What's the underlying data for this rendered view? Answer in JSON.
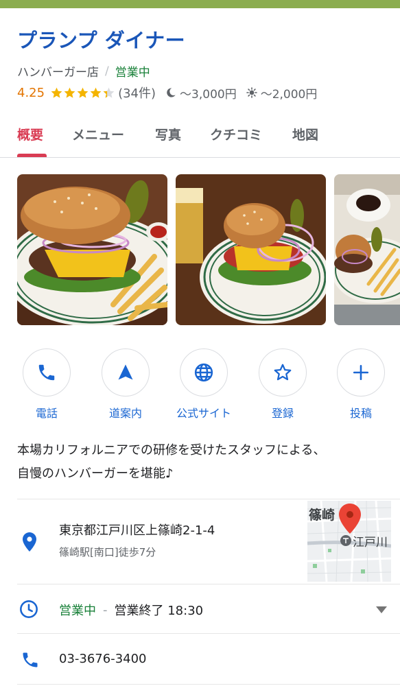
{
  "header": {
    "title": "プランプ ダイナー",
    "category": "ハンバーガー店",
    "separator": "/",
    "status": "営業中"
  },
  "rating": {
    "score": "4.25",
    "stars": 4.25,
    "count": "(34件)",
    "dinner_price": "～3,000円",
    "lunch_price": "～2,000円",
    "dinner_icon": "moon-icon",
    "lunch_icon": "sun-icon"
  },
  "tabs": [
    {
      "label": "概要",
      "active": true
    },
    {
      "label": "メニュー",
      "active": false
    },
    {
      "label": "写真",
      "active": false
    },
    {
      "label": "クチコミ",
      "active": false
    },
    {
      "label": "地図",
      "active": false
    }
  ],
  "photos": [
    {
      "subject": "burger-with-fries-photo"
    },
    {
      "subject": "burger-with-drink-photo"
    },
    {
      "subject": "burger-coffee-photo"
    }
  ],
  "actions": [
    {
      "label": "電話",
      "icon": "phone-icon"
    },
    {
      "label": "道案内",
      "icon": "navigation-arrow-icon"
    },
    {
      "label": "公式サイト",
      "icon": "globe-icon"
    },
    {
      "label": "登録",
      "icon": "star-outline-icon"
    },
    {
      "label": "投稿",
      "icon": "plus-icon"
    }
  ],
  "description": {
    "line1": "本場カリフォルニアでの研修を受けたスタッフによる、",
    "line2": "自慢のハンバーガーを堪能♪"
  },
  "address": {
    "text": "東京都江戸川区上篠崎2-1-4",
    "station": "篠崎駅[南口]徒歩7分",
    "map_label_top": "篠崎",
    "map_label_station": "江戸川"
  },
  "hours": {
    "status": "営業中",
    "dash": "-",
    "closing": "営業終了 18:30"
  },
  "phone": {
    "number": "03-3676-3400"
  },
  "colors": {
    "title": "#1a56b8",
    "open_green": "#188038",
    "rating_orange": "#e37400",
    "star": "#f4b400",
    "tab_active": "#d93c53",
    "action_blue": "#1a66d2",
    "top_strip": "#8bad4f"
  }
}
